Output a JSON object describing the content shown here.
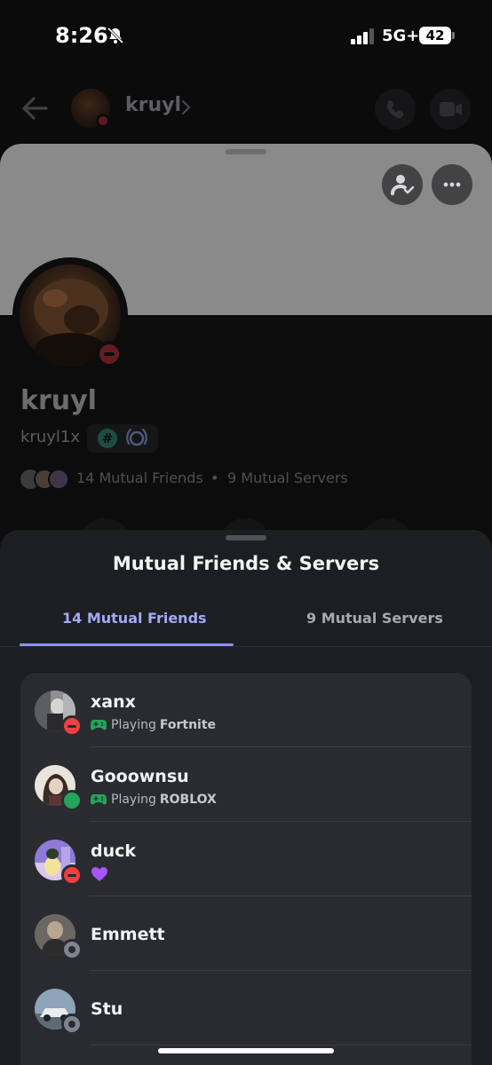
{
  "status_bar": {
    "time": "8:26",
    "network": "5G+",
    "battery": "42"
  },
  "chat_header": {
    "name": "kruyl"
  },
  "profile": {
    "display_name": "kruyl",
    "username": "kruyl1x",
    "mutual_friends_summary": "14 Mutual Friends",
    "separator": "•",
    "mutual_servers_summary": "9 Mutual Servers",
    "status": "dnd"
  },
  "mutual_sheet": {
    "title": "Mutual Friends & Servers",
    "tabs": [
      {
        "label": "14 Mutual Friends",
        "selected": true
      },
      {
        "label": "9 Mutual Servers",
        "selected": false
      }
    ]
  },
  "friends": [
    {
      "name": "xanx",
      "status": "dnd",
      "activity_prefix": "Playing",
      "activity_game": "Fortnite",
      "activity_icon": "gamepad-icon"
    },
    {
      "name": "Gooownsu",
      "status": "online",
      "activity_prefix": "Playing",
      "activity_game": "ROBLOX",
      "activity_icon": "gamepad-icon"
    },
    {
      "name": "duck",
      "status": "dnd",
      "custom_status_icon": "purple-heart-icon"
    },
    {
      "name": "Emmett",
      "status": "offline"
    },
    {
      "name": "Stu",
      "status": "offline"
    }
  ],
  "colors": {
    "accent": "#8b93f5",
    "dnd": "#f23f43",
    "online": "#23a55a",
    "offline": "#80848e",
    "gamepad": "#23a55a",
    "heart": "#a855f7"
  }
}
